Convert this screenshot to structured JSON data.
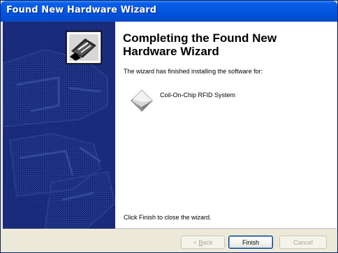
{
  "window": {
    "title": "Found New Hardware Wizard"
  },
  "content": {
    "heading": "Completing the Found New Hardware Wizard",
    "subtext": "The wizard has finished installing the software for:",
    "device_name": "Coil-On-Chip RFID System",
    "device_icon": "hardware-device-icon",
    "footer": "Click Finish to close the wizard."
  },
  "buttons": {
    "back_prefix": "< ",
    "back_mnemonic": "B",
    "back_rest": "ack",
    "finish": "Finish",
    "cancel": "Cancel"
  },
  "colors": {
    "titlebar": "#0457e0",
    "sidebar": "#1a2c7c",
    "dialog_bg": "#ece9d8"
  }
}
